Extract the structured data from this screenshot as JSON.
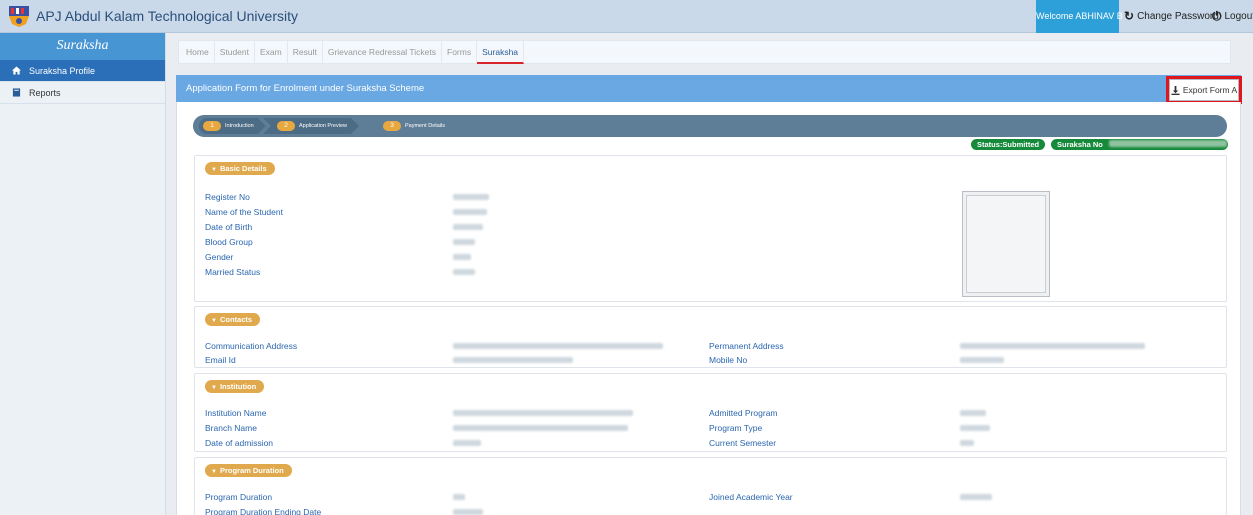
{
  "header": {
    "title": "APJ Abdul Kalam Technological University",
    "welcome": "Welcome ABHINAV B",
    "change_password": "Change Password",
    "logout": "Logout"
  },
  "sidebar": {
    "title": "Suraksha",
    "items": [
      {
        "label": "Suraksha Profile",
        "active": true
      },
      {
        "label": "Reports",
        "active": false
      }
    ]
  },
  "tabs": [
    "Home",
    "Student",
    "Exam",
    "Result",
    "Grievance Redressal Tickets",
    "Forms",
    "Suraksha"
  ],
  "form": {
    "title": "Application Form for Enrolment under Suraksha Scheme",
    "export_label": "Export Form A",
    "steps": [
      {
        "num": "1",
        "label": "Introduction"
      },
      {
        "num": "2",
        "label": "Application Preview"
      },
      {
        "num": "3",
        "label": "Payment Details"
      }
    ],
    "status": "Status:Submitted",
    "suraksha_no_label": "Suraksha No"
  },
  "sections": {
    "basic": {
      "title": "Basic Details",
      "fields": [
        "Register No",
        "Name of the Student",
        "Date of Birth",
        "Blood Group",
        "Gender",
        "Married Status"
      ]
    },
    "contacts": {
      "title": "Contacts",
      "left": [
        "Communication Address",
        "Email Id"
      ],
      "right": [
        "Permanent Address",
        "Mobile No"
      ]
    },
    "institution": {
      "title": "Institution",
      "left": [
        "Institution Name",
        "Branch Name",
        "Date of admission"
      ],
      "right": [
        "Admitted Program",
        "Program Type",
        "Current Semester"
      ]
    },
    "duration": {
      "title": "Program Duration",
      "left": [
        "Program Duration",
        "Program Duration Ending Date"
      ],
      "right": [
        "Joined Academic Year"
      ]
    }
  },
  "colors": {
    "accent": "#2da0d9",
    "header_bar": "#6aa8e4",
    "badge": "#e0a94d",
    "status": "#158a3a",
    "highlight": "#e0161e"
  }
}
